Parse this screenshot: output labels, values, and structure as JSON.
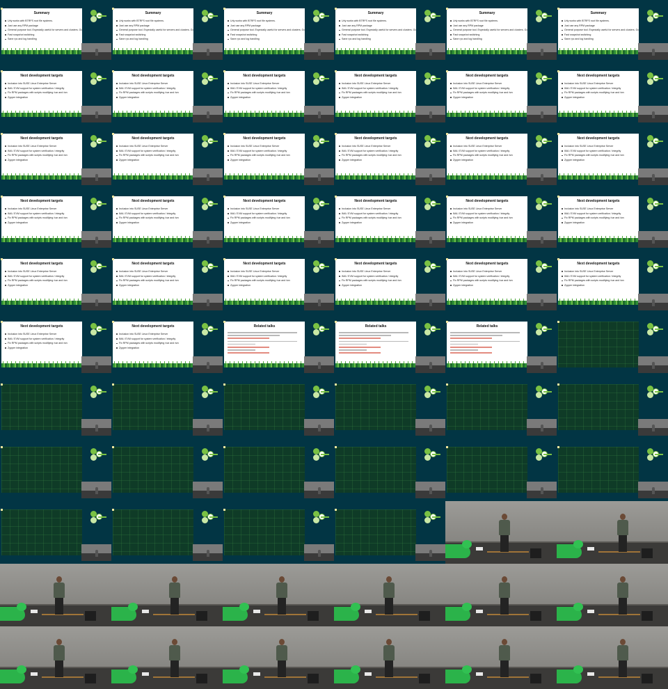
{
  "title": "",
  "grid": {
    "columns": 6,
    "rows": 11
  },
  "slide_text": {
    "summary": {
      "title": "Summary",
      "bullets": [
        "Urly works with BTRFS root file systems.",
        "Just use any RPM package",
        "General purpose tool. Especially useful for servers and clusters. Go (lay and) find its use on desktops",
        "Fast snapshot switching",
        "Sane rpc and log handling"
      ]
    },
    "next": {
      "title": "Next development targets",
      "bullets": [
        "Inclusion into SUSE Linux Enterprise Server",
        "IMA / EVM support for system verification / integrity",
        "Fix RPM packages with scripts modifying /var and /srv",
        "Zypper integration"
      ]
    },
    "related": {
      "title": "Related talks"
    }
  },
  "frames": [
    "summary",
    "summary",
    "summary",
    "summary",
    "summary",
    "summary",
    "next",
    "next",
    "next",
    "next",
    "next",
    "next",
    "next",
    "next",
    "next",
    "next",
    "next",
    "next",
    "next",
    "next",
    "next",
    "next",
    "next",
    "next",
    "next",
    "next",
    "next",
    "next",
    "next",
    "next",
    "next",
    "next",
    "related",
    "related",
    "related",
    "dark",
    "dark",
    "dark",
    "dark",
    "dark",
    "dark",
    "dark",
    "dark",
    "dark",
    "dark",
    "dark",
    "dark",
    "dark",
    "dark",
    "dark",
    "dark",
    "dark",
    "camera",
    "camera",
    "camera",
    "camera",
    "camera",
    "camera",
    "camera",
    "camera",
    "camera",
    "camera",
    "camera",
    "camera",
    "camera",
    "camera"
  ],
  "colors": {
    "background": "#023544",
    "slide": "#ffffff",
    "dark_slide": "#0f3b27",
    "accent": "#7ac143"
  },
  "icons": [
    "geeko-logo-icon"
  ]
}
